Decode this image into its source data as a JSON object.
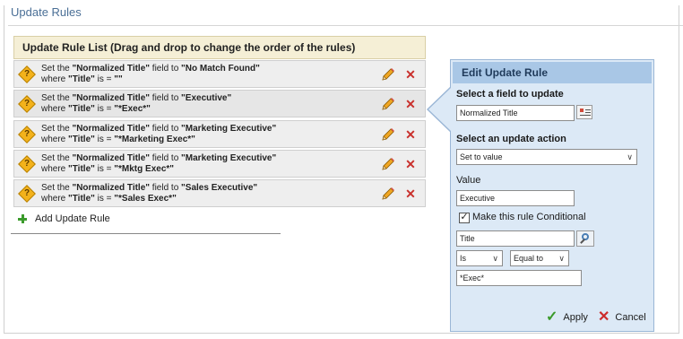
{
  "page": {
    "title": "Update Rules"
  },
  "list": {
    "header": "Update Rule List (Drag and drop to change the order of the rules)",
    "rules": [
      {
        "field": "Normalized Title",
        "value": "No Match Found",
        "where_field": "Title",
        "where_value": ""
      },
      {
        "field": "Normalized Title",
        "value": "Executive",
        "where_field": "Title",
        "where_value": "*Exec*"
      },
      {
        "field": "Normalized Title",
        "value": "Marketing Executive",
        "where_field": "Title",
        "where_value": "*Marketing Exec*"
      },
      {
        "field": "Normalized Title",
        "value": "Marketing Executive",
        "where_field": "Title",
        "where_value": "*Mktg Exec*"
      },
      {
        "field": "Normalized Title",
        "value": "Sales Executive",
        "where_field": "Title",
        "where_value": "*Sales Exec*"
      }
    ],
    "text": {
      "set_the": "Set the ",
      "field_to": " field to ",
      "where": "where ",
      "is": " is = "
    },
    "add_rule_label": "Add Update Rule"
  },
  "edit": {
    "header": "Edit Update Rule",
    "select_field_label": "Select a field to update",
    "field_value": "Normalized Title",
    "select_action_label": "Select an update action",
    "action_value": "Set to value",
    "value_label": "Value",
    "value_value": "Executive",
    "conditional_label": "Make this rule Conditional",
    "conditional_checked": true,
    "condition_field": "Title",
    "operator_is": "Is",
    "operator_compare": "Equal to",
    "condition_value": "*Exec*",
    "apply_label": "Apply",
    "cancel_label": "Cancel"
  },
  "colors": {
    "accent": "#4a6f96",
    "edit_bg": "#dce9f6",
    "edit_header": "#a9c7e6",
    "list_header_bg": "#f5efd6",
    "delete": "#c9302c",
    "add": "#3b9b2c"
  },
  "icons": {
    "rule": "warning-icon",
    "edit": "pencil-icon",
    "delete": "delete-icon",
    "add": "plus-icon",
    "field_picker": "field-picker-icon",
    "lookup": "search-icon",
    "apply": "check-icon",
    "cancel": "x-icon"
  }
}
